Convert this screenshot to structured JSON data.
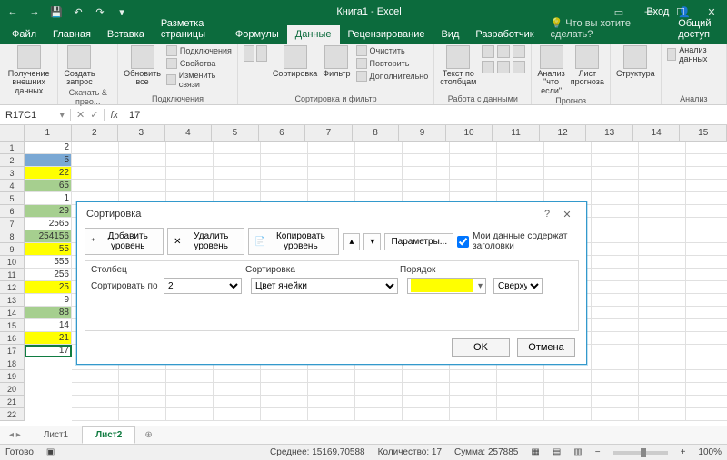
{
  "title": "Книга1 - Excel",
  "tabs": [
    "Файл",
    "Главная",
    "Вставка",
    "Разметка страницы",
    "Формулы",
    "Данные",
    "Рецензирование",
    "Вид",
    "Разработчик"
  ],
  "active_tab": "Данные",
  "tell_me": "Что вы хотите сделать?",
  "signin": "Вход",
  "share": "Общий доступ",
  "ribbon": {
    "g1": {
      "btn": "Получение\nвнешних данных",
      "label": ""
    },
    "g2": {
      "btn": "Создать\nзапрос",
      "label": "Скачать & прео..."
    },
    "g3": {
      "btn": "Обновить\nвсе",
      "items": [
        "Подключения",
        "Свойства",
        "Изменить связи"
      ],
      "label": "Подключения"
    },
    "g4": {
      "b1": "Сортировка",
      "b2": "Фильтр",
      "items": [
        "Очистить",
        "Повторить",
        "Дополнительно"
      ],
      "label": "Сортировка и фильтр"
    },
    "g5": {
      "btn": "Текст по\nстолбцам",
      "label": "Работа с данными"
    },
    "g6": {
      "b1": "Анализ \"что\nесли\"",
      "b2": "Лист\nпрогноза",
      "label": "Прогноз"
    },
    "g7": {
      "btn": "Структура"
    },
    "g8": {
      "btn": "Анализ данных",
      "label": "Анализ"
    }
  },
  "namebox": "R17C1",
  "formula_value": "17",
  "columns": [
    "1",
    "2",
    "3",
    "4",
    "5",
    "6",
    "7",
    "8",
    "9",
    "10",
    "11",
    "12",
    "13",
    "14",
    "15"
  ],
  "rows_count": 22,
  "data_column": [
    {
      "v": "2",
      "bg": "#ffffff"
    },
    {
      "v": "5",
      "bg": "#7aa8d4"
    },
    {
      "v": "22",
      "bg": "#ffff00"
    },
    {
      "v": "65",
      "bg": "#a6cf8f"
    },
    {
      "v": "1",
      "bg": "#ffffff"
    },
    {
      "v": "29",
      "bg": "#a6cf8f"
    },
    {
      "v": "2565",
      "bg": "#ffffff"
    },
    {
      "v": "254156",
      "bg": "#a6cf8f"
    },
    {
      "v": "55",
      "bg": "#ffff00"
    },
    {
      "v": "555",
      "bg": "#ffffff"
    },
    {
      "v": "256",
      "bg": "#ffffff"
    },
    {
      "v": "25",
      "bg": "#ffff00"
    },
    {
      "v": "9",
      "bg": "#ffffff"
    },
    {
      "v": "88",
      "bg": "#a6cf8f"
    },
    {
      "v": "14",
      "bg": "#ffffff"
    },
    {
      "v": "21",
      "bg": "#ffff00"
    },
    {
      "v": "17",
      "bg": "#ffffff"
    }
  ],
  "sheets": [
    "Лист1",
    "Лист2"
  ],
  "active_sheet": "Лист2",
  "status": {
    "ready": "Готово",
    "avg_label": "Среднее:",
    "avg": "15169,70588",
    "count_label": "Количество:",
    "count": "17",
    "sum_label": "Сумма:",
    "sum": "257885",
    "zoom": "100%"
  },
  "dialog": {
    "title": "Сортировка",
    "add": "Добавить уровень",
    "del": "Удалить уровень",
    "copy": "Копировать уровень",
    "params": "Параметры...",
    "headers_chk": "Мои данные содержат заголовки",
    "col_hdr": "Столбец",
    "sort_hdr": "Сортировка",
    "order_hdr": "Порядок",
    "sortby": "Сортировать по",
    "col_val": "2",
    "sort_val": "Цвет ячейки",
    "order_side": "Сверху",
    "ok": "OK",
    "cancel": "Отмена"
  }
}
